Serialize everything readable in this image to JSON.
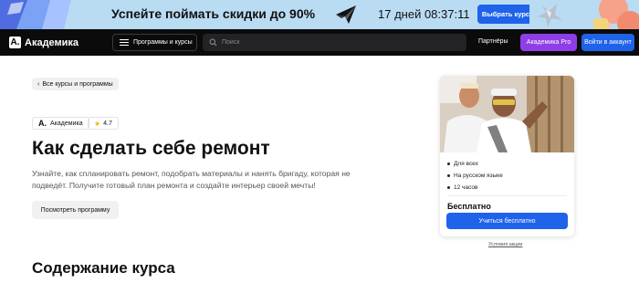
{
  "promo": {
    "text": "Успейте поймать скидки до 90%",
    "timer": "17 дней 08:37:11",
    "button_label": "Выбрать курс"
  },
  "header": {
    "logo_mark": "A.",
    "logo_text": "Академика",
    "programs_label": "Программы и курсы",
    "search_placeholder": "Поиск",
    "partners_label": "Партнёры",
    "pro_label": "Академика Pro",
    "login_label": "Войти в аккаунт"
  },
  "main": {
    "back_link": "Все курсы и программы",
    "provider_logo": "A.",
    "provider_name": "Академика",
    "rating": "4.7",
    "title": "Как сделать себе ремонт",
    "description": "Узнайте, как спланировать ремонт, подобрать материалы и нанять бригаду, которая не подведёт. Получите готовый план ремонта и создайте интерьер своей мечты!",
    "view_button": "Посмотреть программу",
    "section_title": "Содержание курса"
  },
  "card": {
    "features": [
      "Для всех",
      "На русском языке",
      "12 часов"
    ],
    "price": "Бесплатно",
    "enroll_button": "Учиться бесплатно",
    "terms_link": "Условия акции"
  },
  "colors": {
    "accent": "#1e63e9",
    "pro": "#8e3ee6",
    "banner": "#b9dcf3",
    "header": "#0b0b0c"
  }
}
